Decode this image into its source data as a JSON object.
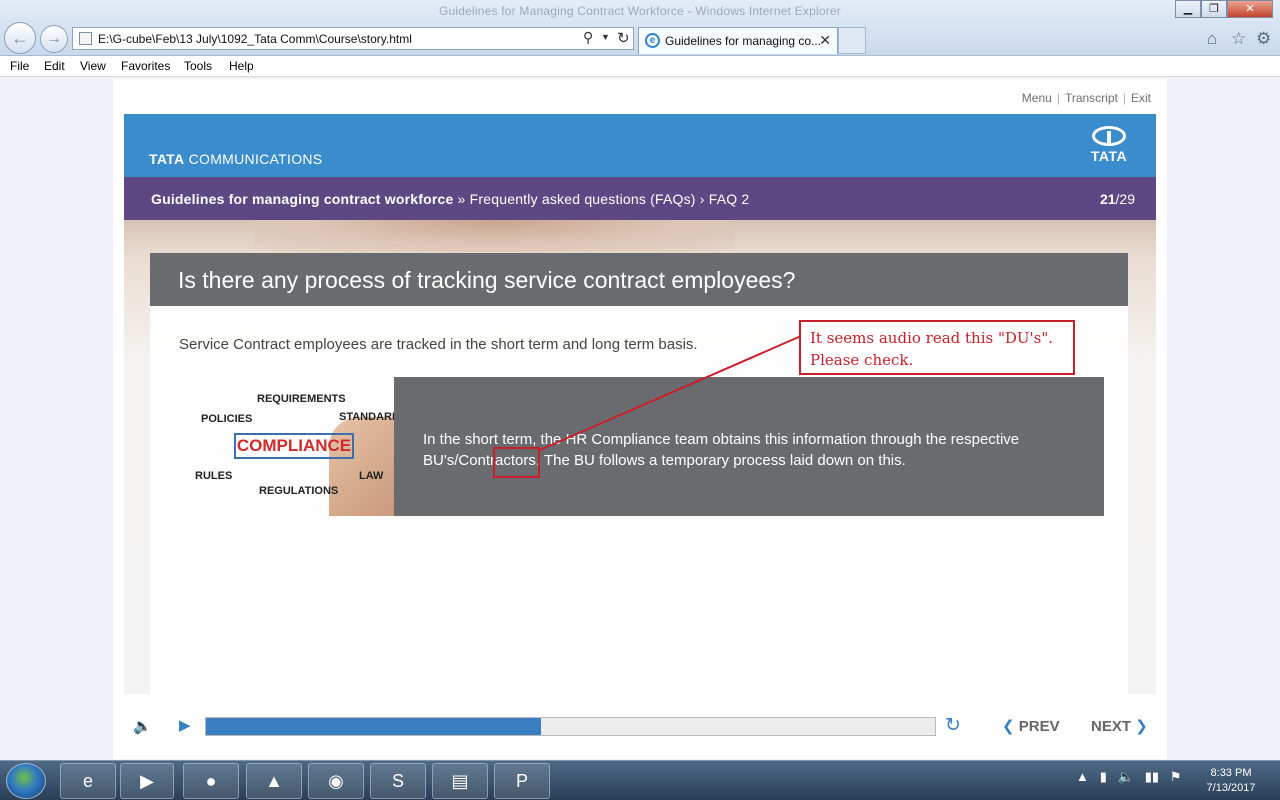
{
  "window": {
    "title": "Guidelines for Managing Contract Workforce - Windows Internet Explorer",
    "controls": {
      "minimize": "▁",
      "maximize": "❐",
      "close": "✕"
    }
  },
  "browser": {
    "address": "E:\\G-cube\\Feb\\13 July\\1092_Tata Comm\\Course\\story.html",
    "tab_label": "Guidelines for managing co...",
    "tab_close": "✕",
    "icons": {
      "back": "arrow-left",
      "forward": "arrow-right",
      "search": "magnifier",
      "refresh": "refresh",
      "home": "home",
      "favorites": "star",
      "tools": "gear"
    }
  },
  "menubar": {
    "items": [
      "File",
      "Edit",
      "View",
      "Favorites",
      "Tools",
      "Help"
    ]
  },
  "player": {
    "top_links": [
      "Menu",
      "Transcript",
      "Exit"
    ],
    "brand": {
      "bold": "TATA",
      "rest": " COMMUNICATIONS",
      "logo_text": "TATA"
    },
    "breadcrumb": {
      "main": "Guidelines for managing contract workforce",
      "sep1": " » ",
      "section": "Frequently asked questions (FAQs)",
      "sep2": " › ",
      "page": "FAQ 2"
    },
    "page_current": "21",
    "page_total": "/29",
    "question": "Is there any process of tracking service contract employees?",
    "intro": "Service Contract employees are tracked in the short term and long term basis.",
    "image_words": {
      "requirements": "REQUIREMENTS",
      "policies": "POLICIES",
      "standard": "STANDARD",
      "compliance": "COMPLIANCE",
      "rules": "RULES",
      "regulations": "REGULATIONS",
      "law": "LAW"
    },
    "answer": "In the short term, the HR Compliance team obtains this information through the respective BU's/Contractors. The BU follows a temporary process laid down on this.",
    "controls": {
      "prev": "PREV",
      "next": "NEXT",
      "progress_fraction": 0.46
    }
  },
  "annotation": {
    "line1": "It seems audio read this \"DU's\".",
    "line2": "Please check.",
    "color": "#c8202a"
  },
  "taskbar": {
    "apps": [
      "internet-explorer",
      "media-player",
      "firefox",
      "vlc",
      "chrome",
      "app-s",
      "file-explorer",
      "powerpoint"
    ],
    "time": "8:33 PM",
    "date": "7/13/2017"
  },
  "colors": {
    "brand_blue": "#3b8ccc",
    "breadcrumb_purple": "#5d4884",
    "panel_gray": "#6a6b6f",
    "accent_blue": "#3a7fc1"
  }
}
